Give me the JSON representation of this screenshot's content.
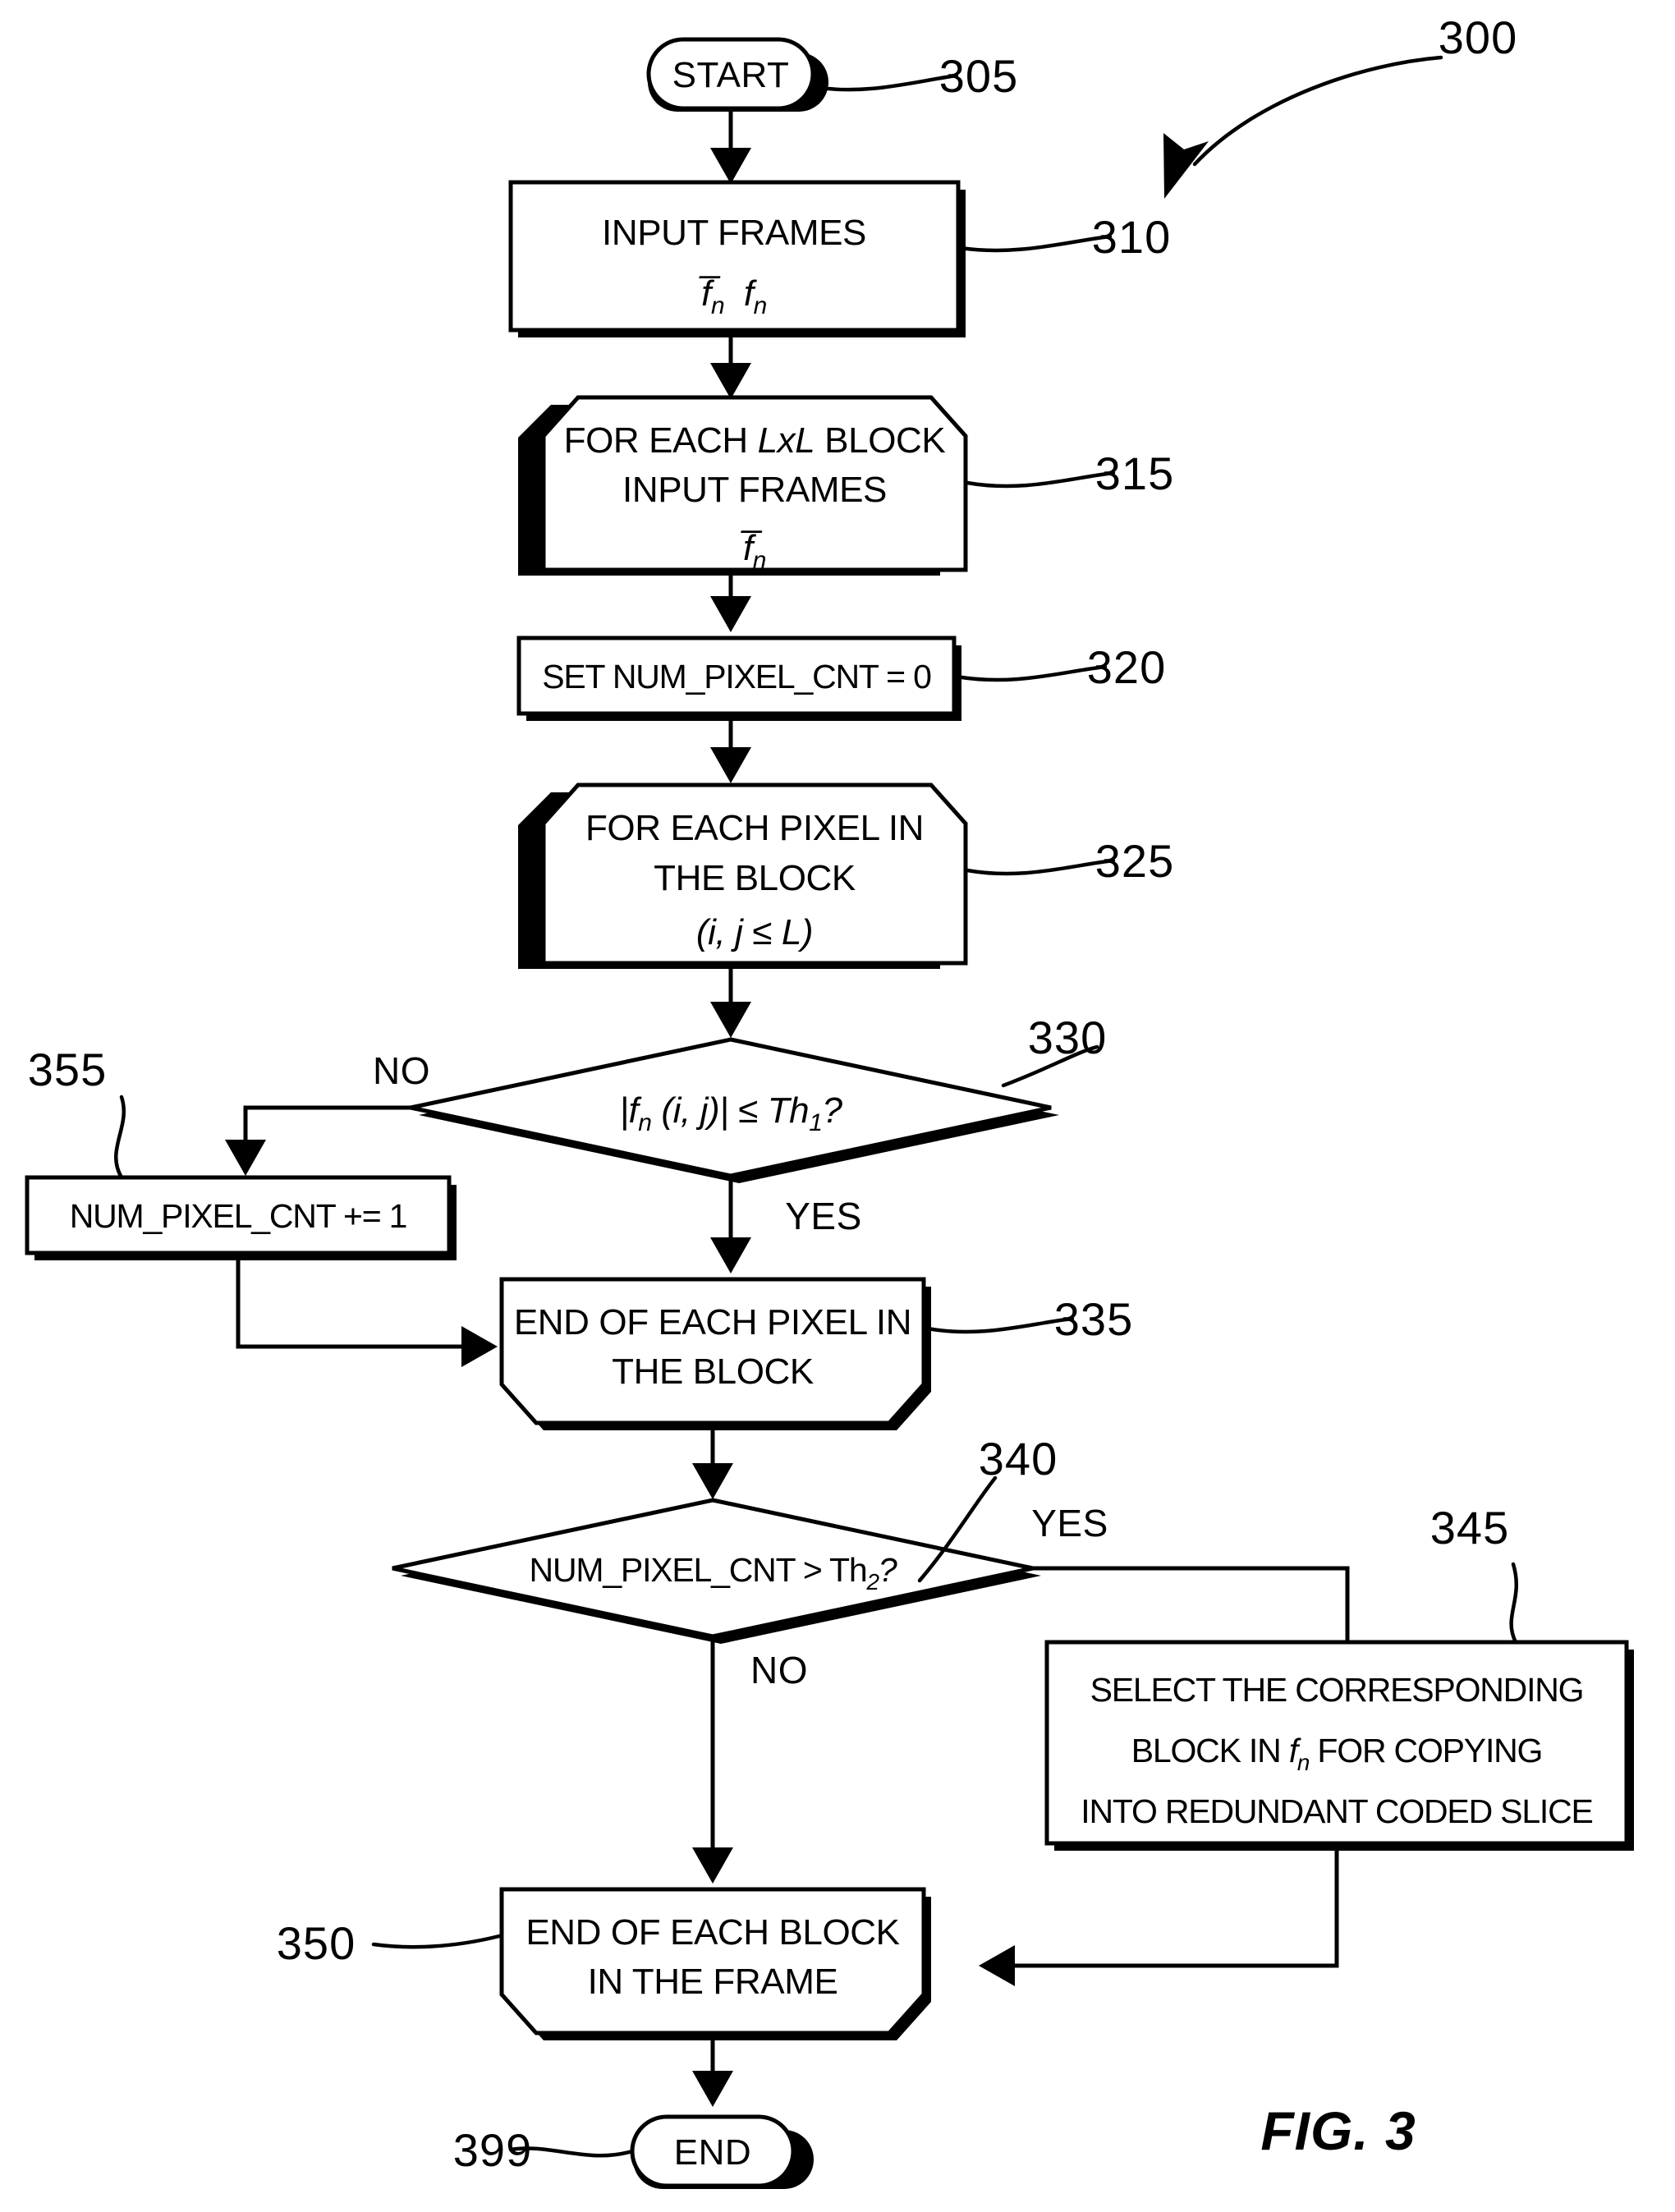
{
  "figure": {
    "label": "FIG. 3",
    "diagram_ref": "300"
  },
  "nodes": {
    "start": {
      "ref": "305",
      "label": "START",
      "shape": "terminator"
    },
    "input_frames": {
      "ref": "310",
      "shape": "process",
      "line1": "INPUT FRAMES",
      "line2_a": "f",
      "line2_a_sub": "n",
      "line2_b": "f",
      "line2_b_sub": "n"
    },
    "for_each_block": {
      "ref": "315",
      "shape": "loop-start",
      "line1_a": "FOR EACH ",
      "line1_b": "LxL",
      "line1_c": " BLOCK",
      "line2": "INPUT FRAMES",
      "line3": "f",
      "line3_sub": "n"
    },
    "set_counter": {
      "ref": "320",
      "shape": "process",
      "line1": "SET NUM_PIXEL_CNT = 0"
    },
    "for_each_pixel": {
      "ref": "325",
      "shape": "loop-start",
      "line1": "FOR EACH PIXEL IN",
      "line2": "THE BLOCK",
      "line3": "(i, j ≤ L)"
    },
    "threshold_check": {
      "ref": "330",
      "shape": "decision",
      "expr_abs_open": "|f",
      "expr_sub": "n",
      "expr_args": " (i, j)| ≤ Th",
      "expr_th_sub": "1",
      "expr_q": "?",
      "branch_no": "NO",
      "branch_yes": "YES"
    },
    "increment_counter": {
      "ref": "355",
      "shape": "process",
      "line1": "NUM_PIXEL_CNT += 1"
    },
    "end_each_pixel": {
      "ref": "335",
      "shape": "loop-end",
      "line1": "END OF EACH PIXEL IN",
      "line2": "THE BLOCK"
    },
    "count_check": {
      "ref": "340",
      "shape": "decision",
      "expr_a": "NUM_PIXEL_CNT > Th",
      "expr_sub": "2",
      "expr_q": "?",
      "branch_yes": "YES",
      "branch_no": "NO"
    },
    "select_block": {
      "ref": "345",
      "shape": "process",
      "line1": "SELECT THE CORRESPONDING",
      "line2_a": "BLOCK IN ",
      "line2_b": "f",
      "line2_b_sub": "n",
      "line2_c": " FOR COPYING",
      "line3": "INTO REDUNDANT CODED SLICE"
    },
    "end_each_block": {
      "ref": "350",
      "shape": "loop-end",
      "line1": "END OF EACH BLOCK",
      "line2": "IN THE FRAME"
    },
    "end": {
      "ref": "399",
      "label": "END",
      "shape": "terminator"
    }
  },
  "colors": {
    "ink": "#000000",
    "paper": "#ffffff"
  }
}
